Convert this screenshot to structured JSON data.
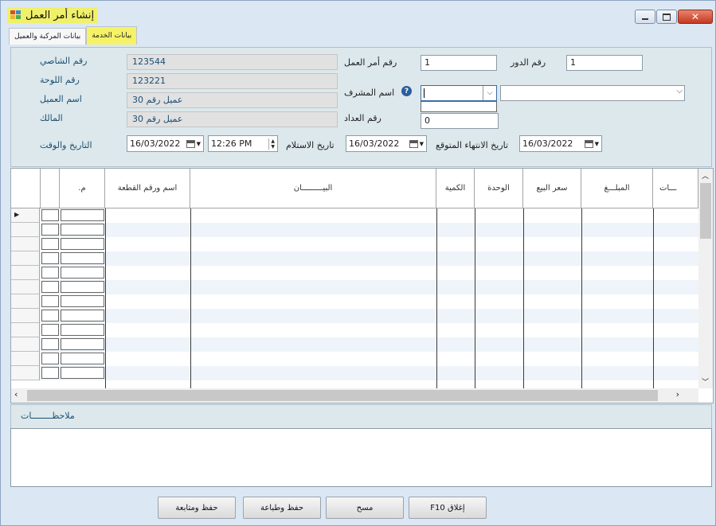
{
  "window": {
    "title": "إنشاء أمر العمل"
  },
  "tabs": [
    {
      "label": "بيانات المركبة والعميل"
    },
    {
      "label": "بيانات الخدمة"
    }
  ],
  "form": {
    "chassis_label": "رقم الشاصي",
    "chassis_value": "123544",
    "plate_label": "رقم اللوحة",
    "plate_value": "123221",
    "customer_label": "اسم العميل",
    "customer_value": "عميل رقم 30",
    "owner_label": "المالك",
    "owner_value": "عميل رقم 30",
    "datetime_label": "التاريخ والوقت",
    "date_value": "16/03/2022",
    "time_value": "12:26 PM",
    "work_order_label": "رقم أمر العمل",
    "work_order_value": "1",
    "turn_label": "رقم الدور",
    "turn_value": "1",
    "supervisor_label": "اسم المشرف",
    "supervisor_value": "",
    "meter_label": "رقم العداد",
    "meter_value": "0",
    "receive_label": "تاريخ الاستلام",
    "receive_date": "16/03/2022",
    "expected_end_label": "تاريخ الانتهاء المتوقع",
    "expected_end_date": "16/03/2022"
  },
  "grid": {
    "columns": [
      ".م",
      "اسم ورقم القطعة",
      "البيـــــــــان",
      "الكمية",
      "الوحدة",
      "سعر البيع",
      "المبلـــغ",
      "ـــات"
    ]
  },
  "notes": {
    "label": "ملاحظــــــــات"
  },
  "buttons": {
    "save_follow": "حفظ ومتابعة",
    "save_print": "حفظ وطباعة",
    "clear": "مسح",
    "close": "F10 إغلاق"
  }
}
